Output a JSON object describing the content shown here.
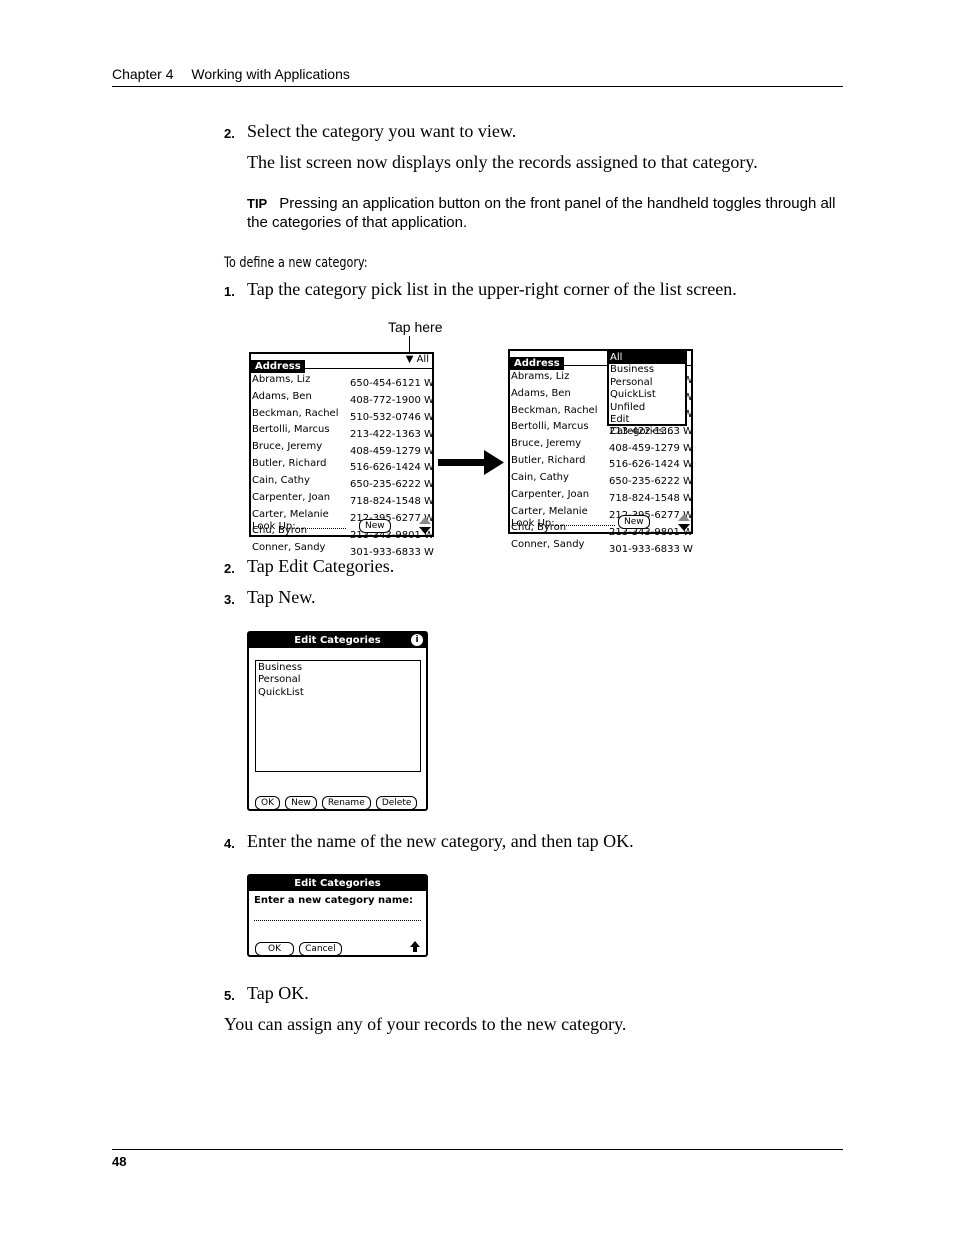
{
  "header": {
    "chapter": "Chapter 4",
    "title": "Working with Applications"
  },
  "steps_top": [
    {
      "num": "2.",
      "text": "Select the category you want to view."
    }
  ],
  "para_after_step2": "The list screen now displays only the records assigned to that category.",
  "tip": {
    "label": "TIP",
    "text": "Pressing an application button on the front panel of the handheld toggles through all the categories of that application."
  },
  "subheading": "To define a new category:",
  "step1": {
    "num": "1.",
    "text": "Tap the category pick list in the upper-right corner of the list screen."
  },
  "callout": "Tap here",
  "address_screen": {
    "title": "Address",
    "category": "All",
    "records": [
      {
        "name": "Abrams, Liz",
        "phone": "650-454-6121 W"
      },
      {
        "name": "Adams, Ben",
        "phone": "408-772-1900 W"
      },
      {
        "name": "Beckman, Rachel",
        "phone": "510-532-0746 W"
      },
      {
        "name": "Bertolli, Marcus",
        "phone": "213-422-1363 W"
      },
      {
        "name": "Bruce, Jeremy",
        "phone": "408-459-1279 W"
      },
      {
        "name": "Butler, Richard",
        "phone": "516-626-1424 W"
      },
      {
        "name": "Cain, Cathy",
        "phone": "650-235-6222 W"
      },
      {
        "name": "Carpenter, Joan",
        "phone": "718-824-1548 W"
      },
      {
        "name": "Carter, Melanie",
        "phone": "212-395-6277 W"
      },
      {
        "name": "Chu, Byron",
        "phone": "213-343-9801 W"
      },
      {
        "name": "Conner, Sandy",
        "phone": "301-933-6833 W"
      }
    ],
    "lookup_label": "Look Up:",
    "new_button": "New"
  },
  "category_popup": {
    "items": [
      "All",
      "Business",
      "Personal",
      "QuickList",
      "Unfiled",
      "Edit Categories..."
    ]
  },
  "step2": {
    "num": "2.",
    "text": "Tap Edit Categories."
  },
  "step3": {
    "num": "3.",
    "text": "Tap New."
  },
  "edit_categories": {
    "title": "Edit Categories",
    "items": [
      "Business",
      "Personal",
      "QuickList"
    ],
    "buttons": {
      "ok": "OK",
      "new": "New",
      "rename": "Rename",
      "delete": "Delete"
    }
  },
  "step4": {
    "num": "4.",
    "text": "Enter the name of the new category, and then tap OK."
  },
  "new_category_dialog": {
    "title": "Edit Categories",
    "prompt": "Enter a new category name:",
    "buttons": {
      "ok": "OK",
      "cancel": "Cancel"
    }
  },
  "step5": {
    "num": "5.",
    "text": "Tap OK."
  },
  "closing": "You can assign any of your records to the new category.",
  "footer": {
    "page_number": "48"
  }
}
